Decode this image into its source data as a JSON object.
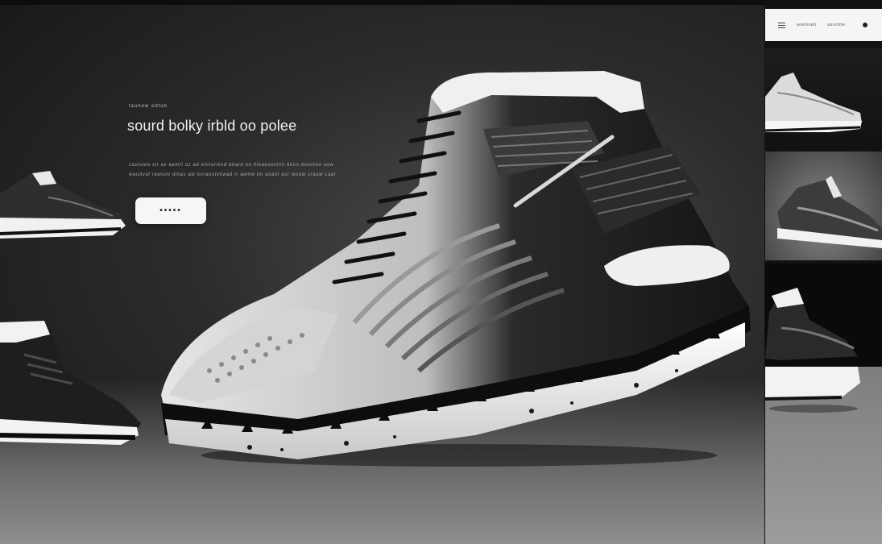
{
  "hero": {
    "eyebrow": "tauhow edtub",
    "headline": "sourd bolky irbld oo polee",
    "body_lines": [
      "cauruwe sir ax aemrl oz ad enriurmxd dnard oo tlmaeuomlin deco doontoo sow",
      "waudvaf rawoov dmas aw onraoonmwad ir aemw bn aoant aur woow srauw caar"
    ],
    "cta_label": "•••••"
  },
  "nav": {
    "menu_icon": "hamburger-menu-icon",
    "links": [
      "aoemoeb",
      "auoomw"
    ],
    "account_icon": "dot-icon"
  },
  "thumbnails": [
    {
      "name": "white-sneaker-thumb"
    },
    {
      "name": "grey-sneaker-thumb"
    },
    {
      "name": "black-sneaker-thumb"
    }
  ],
  "colors": {
    "background": "#1c1c1c",
    "cta_background": "#f6f6f6",
    "navbar": "#f5f5f5"
  }
}
